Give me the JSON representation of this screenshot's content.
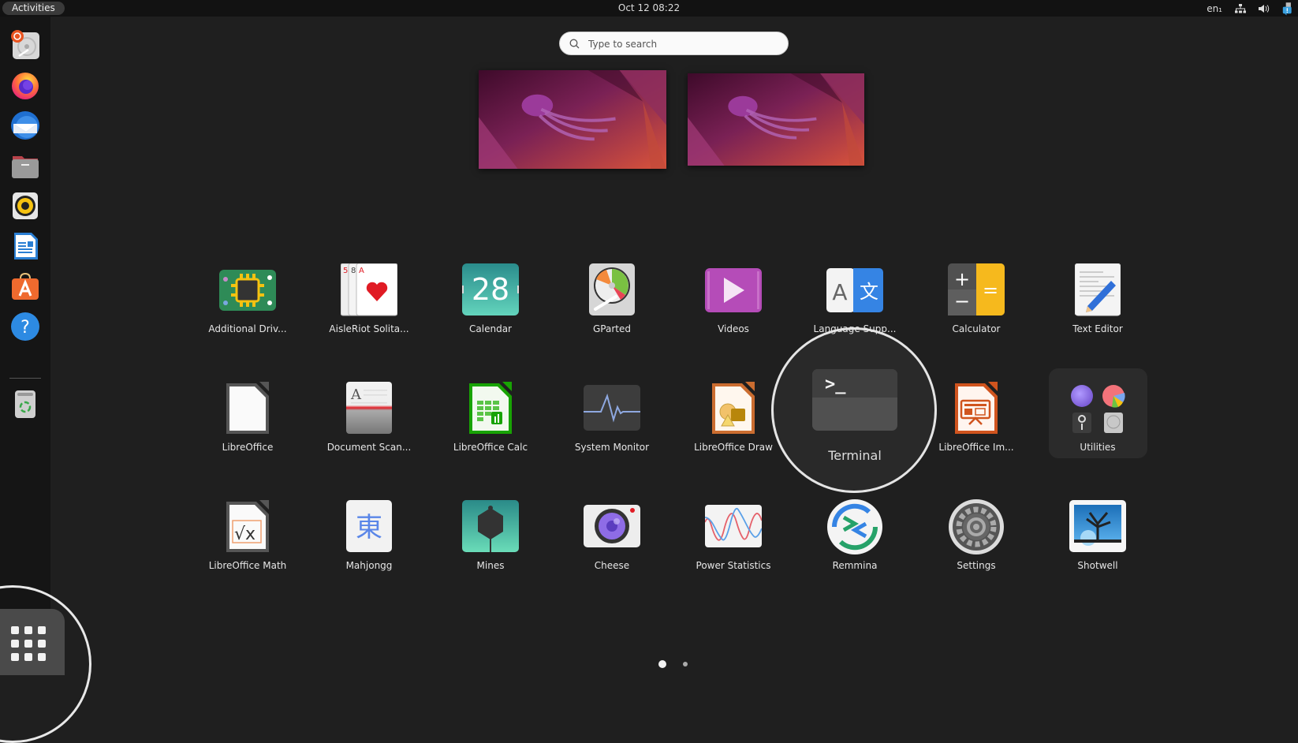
{
  "topbar": {
    "activities_label": "Activities",
    "clock": "Oct 12  08:22",
    "keyboard_layout": "en₁",
    "tray_icons": [
      "network-icon",
      "volume-icon",
      "notification-icon"
    ]
  },
  "dock": {
    "items": [
      {
        "name": "Ubuntu Installer",
        "icon": "installer-icon"
      },
      {
        "name": "Firefox",
        "icon": "firefox-icon"
      },
      {
        "name": "Thunderbird",
        "icon": "thunderbird-icon"
      },
      {
        "name": "Files",
        "icon": "files-icon"
      },
      {
        "name": "Rhythmbox",
        "icon": "rhythmbox-icon"
      },
      {
        "name": "LibreOffice Writer",
        "icon": "writer-icon"
      },
      {
        "name": "Ubuntu Software",
        "icon": "software-icon"
      },
      {
        "name": "Help",
        "icon": "help-icon"
      },
      {
        "name": "Trash",
        "icon": "trash-icon"
      }
    ],
    "show_apps_label": "Show Applications"
  },
  "search": {
    "placeholder": "Type to search",
    "value": ""
  },
  "workspaces": [
    {
      "name": "Workspace 1"
    },
    {
      "name": "Workspace 2"
    }
  ],
  "app_grid": {
    "rows": [
      [
        {
          "label": "Additional Driv...",
          "icon": "chip-icon"
        },
        {
          "label": "AisleRiot Solita...",
          "icon": "cards-icon"
        },
        {
          "label": "Calendar",
          "icon": "calendar-icon",
          "day": "28"
        },
        {
          "label": "GParted",
          "icon": "gparted-icon"
        },
        {
          "label": "Videos",
          "icon": "videos-icon"
        },
        {
          "label": "Language Supp...",
          "icon": "language-icon"
        },
        {
          "label": "Calculator",
          "icon": "calculator-icon"
        },
        {
          "label": "Text Editor",
          "icon": "text-editor-icon"
        }
      ],
      [
        {
          "label": "LibreOffice",
          "icon": "libreoffice-icon"
        },
        {
          "label": "Document Scan...",
          "icon": "scanner-icon"
        },
        {
          "label": "LibreOffice Calc",
          "icon": "calc-icon"
        },
        {
          "label": "System Monitor",
          "icon": "system-monitor-icon"
        },
        {
          "label": "LibreOffice Draw",
          "icon": "draw-icon"
        },
        {
          "label": "Terminal",
          "icon": "terminal-icon",
          "highlighted": true
        },
        {
          "label": "LibreOffice Im...",
          "icon": "impress-icon"
        },
        {
          "label": "Utilities",
          "icon": "folder-icon",
          "folder": true
        }
      ],
      [
        {
          "label": "LibreOffice Math",
          "icon": "math-icon"
        },
        {
          "label": "Mahjongg",
          "icon": "mahjongg-icon",
          "glyph": "東"
        },
        {
          "label": "Mines",
          "icon": "mines-icon"
        },
        {
          "label": "Cheese",
          "icon": "cheese-icon"
        },
        {
          "label": "Power Statistics",
          "icon": "power-stats-icon"
        },
        {
          "label": "Remmina",
          "icon": "remmina-icon"
        },
        {
          "label": "Settings",
          "icon": "settings-icon"
        },
        {
          "label": "Shotwell",
          "icon": "shotwell-icon"
        }
      ]
    ],
    "terminal_prompt": ">_",
    "calculator_symbols": [
      "+",
      "−",
      "="
    ],
    "language_letters": [
      "A",
      "文"
    ],
    "page_count": 2,
    "current_page": 1
  },
  "colors": {
    "background": "#1f1f1f",
    "topbar": "#121212",
    "dock": "#151515",
    "accent_orange": "#e95420"
  }
}
